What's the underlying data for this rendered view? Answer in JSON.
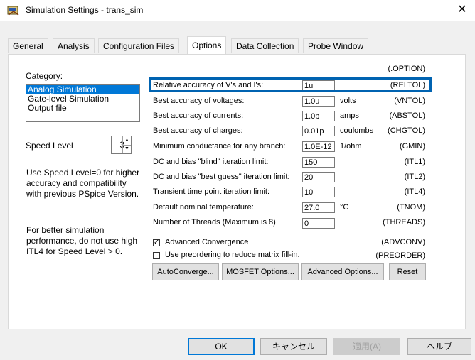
{
  "window": {
    "title": "Simulation Settings - trans_sim",
    "close_glyph": "✕"
  },
  "tabs": [
    {
      "label": "General",
      "active": false
    },
    {
      "label": "Analysis",
      "active": false
    },
    {
      "label": "Configuration Files",
      "active": false
    },
    {
      "label": "Options",
      "active": true
    },
    {
      "label": "Data Collection",
      "active": false
    },
    {
      "label": "Probe Window",
      "active": false
    }
  ],
  "left": {
    "category_label": "Category:",
    "category_items": [
      {
        "label": "Analog Simulation",
        "selected": true
      },
      {
        "label": "Gate-level Simulation",
        "selected": false
      },
      {
        "label": "Output file",
        "selected": false
      }
    ],
    "speed_label": "Speed Level",
    "speed_value": "3",
    "help1": "Use Speed Level=0 for higher accuracy and compatibility with previous PSpice Version.",
    "help2": "For better simulation performance, do not use high ITL4 for Speed Level > 0."
  },
  "options": {
    "header": "(.OPTION)",
    "rows": [
      {
        "label": "Relative accuracy of V's and I's:",
        "value": "1u",
        "unit": "",
        "key": "(RELTOL)"
      },
      {
        "label": "Best accuracy of voltages:",
        "value": "1.0u",
        "unit": "volts",
        "key": "(VNTOL)"
      },
      {
        "label": "Best accuracy of currents:",
        "value": "1.0p",
        "unit": "amps",
        "key": "(ABSTOL)"
      },
      {
        "label": "Best accuracy of charges:",
        "value": "0.01p",
        "unit": "coulombs",
        "key": "(CHGTOL)"
      },
      {
        "label": "Minimum conductance for any branch:",
        "value": "1.0E-12",
        "unit": "1/ohm",
        "key": "(GMIN)"
      },
      {
        "label": "DC and bias \"blind\" iteration limit:",
        "value": "150",
        "unit": "",
        "key": "(ITL1)"
      },
      {
        "label": "DC and bias \"best guess\" iteration limit:",
        "value": "20",
        "unit": "",
        "key": "(ITL2)"
      },
      {
        "label": "Transient time point iteration limit:",
        "value": "10",
        "unit": "",
        "key": "(ITL4)"
      },
      {
        "label": "Default nominal temperature:",
        "value": "27.0",
        "unit": "°C",
        "key": "(TNOM)"
      },
      {
        "label": "Number of Threads (Maximum is 8)",
        "value": "0",
        "unit": "",
        "key": "(THREADS)"
      }
    ],
    "checks": [
      {
        "label": "Advanced Convergence",
        "checked": true,
        "key": "(ADVCONV)"
      },
      {
        "label": "Use preordering to reduce matrix fill-in.",
        "checked": false,
        "key": "(PREORDER)"
      }
    ],
    "check_glyph": "✓"
  },
  "panel_buttons": {
    "autoconverge": "AutoConverge...",
    "mosfet": "MOSFET Options...",
    "advanced": "Advanced Options...",
    "reset": "Reset"
  },
  "bottom_buttons": {
    "ok": "OK",
    "cancel": "キャンセル",
    "apply": "適用(A)",
    "help": "ヘルプ"
  },
  "colors": {
    "selection": "#0078d7",
    "highlight_border": "#0063b1"
  }
}
